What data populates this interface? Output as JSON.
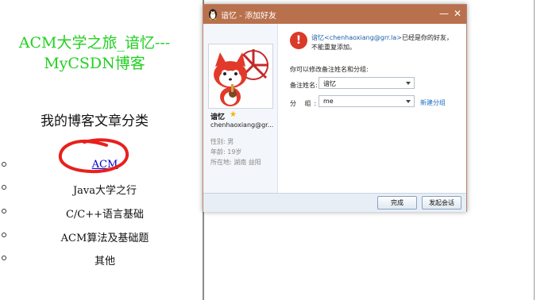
{
  "blog": {
    "title_line1": "ACM大学之旅_谙忆---",
    "title_line2": "MyCSDN博客",
    "category_heading": "我的博客文章分类",
    "categories": [
      "ACM",
      "Java大学之行",
      "C/C++语言基础",
      "ACM算法及基础题",
      "其他"
    ]
  },
  "dialog": {
    "title": "谙忆 - 添加好友",
    "profile": {
      "name": "谙忆",
      "email": "chenhaoxiang@gr...",
      "gender": "性别: 男",
      "age": "年龄: 19岁",
      "location": "所在地: 湖南 益阳"
    },
    "message": {
      "name_part": "谙忆<chenhaoxiang@grr.la>",
      "line1_rest": "已经是你的好友，",
      "line2": "不能重复添加。"
    },
    "edit_hint": "你可以修改备注姓名和分组:",
    "remark_label": "备注姓名:",
    "remark_value": "谙忆",
    "group_label": "分  组:",
    "group_value": "me",
    "new_group_link": "新建分组",
    "done_button": "完成",
    "chat_button": "发起会话"
  },
  "colors": {
    "title_green": "#22d022",
    "titlebar": "#b9704d",
    "link_blue": "#0000cc",
    "annotation_red": "#e8201c"
  },
  "icons": {
    "title_icon": "qq-penguin-icon",
    "warning": "warning-icon",
    "star": "star-icon",
    "minimize": "minimize-icon",
    "close": "close-icon"
  }
}
